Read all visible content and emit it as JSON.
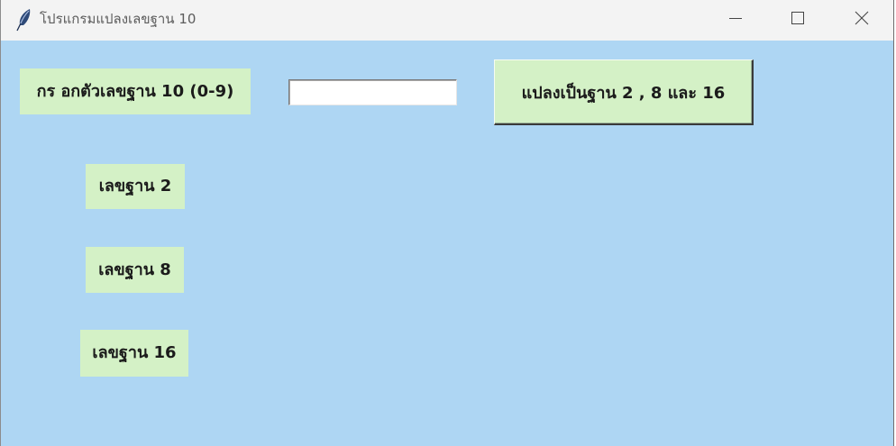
{
  "window": {
    "title": "โปรแกรมแปลงเลขฐาน 10",
    "icons": {
      "app": "feather-icon",
      "minimize": "minimize-icon",
      "maximize": "maximize-icon",
      "close": "close-icon"
    }
  },
  "colors": {
    "background": "#aed6f3",
    "label_background": "#d4f1c6",
    "titlebar": "#f3f3f3",
    "text": "#1b1b1b"
  },
  "form": {
    "input_label": "กร อกตัวเลขฐาน 10 (0-9)",
    "input_value": "",
    "convert_button": "แปลงเป็นฐาน 2 , 8 และ 16"
  },
  "results": {
    "base2_label": "เลขฐาน 2",
    "base8_label": "เลขฐาน 8",
    "base16_label": "เลขฐาน 16"
  }
}
